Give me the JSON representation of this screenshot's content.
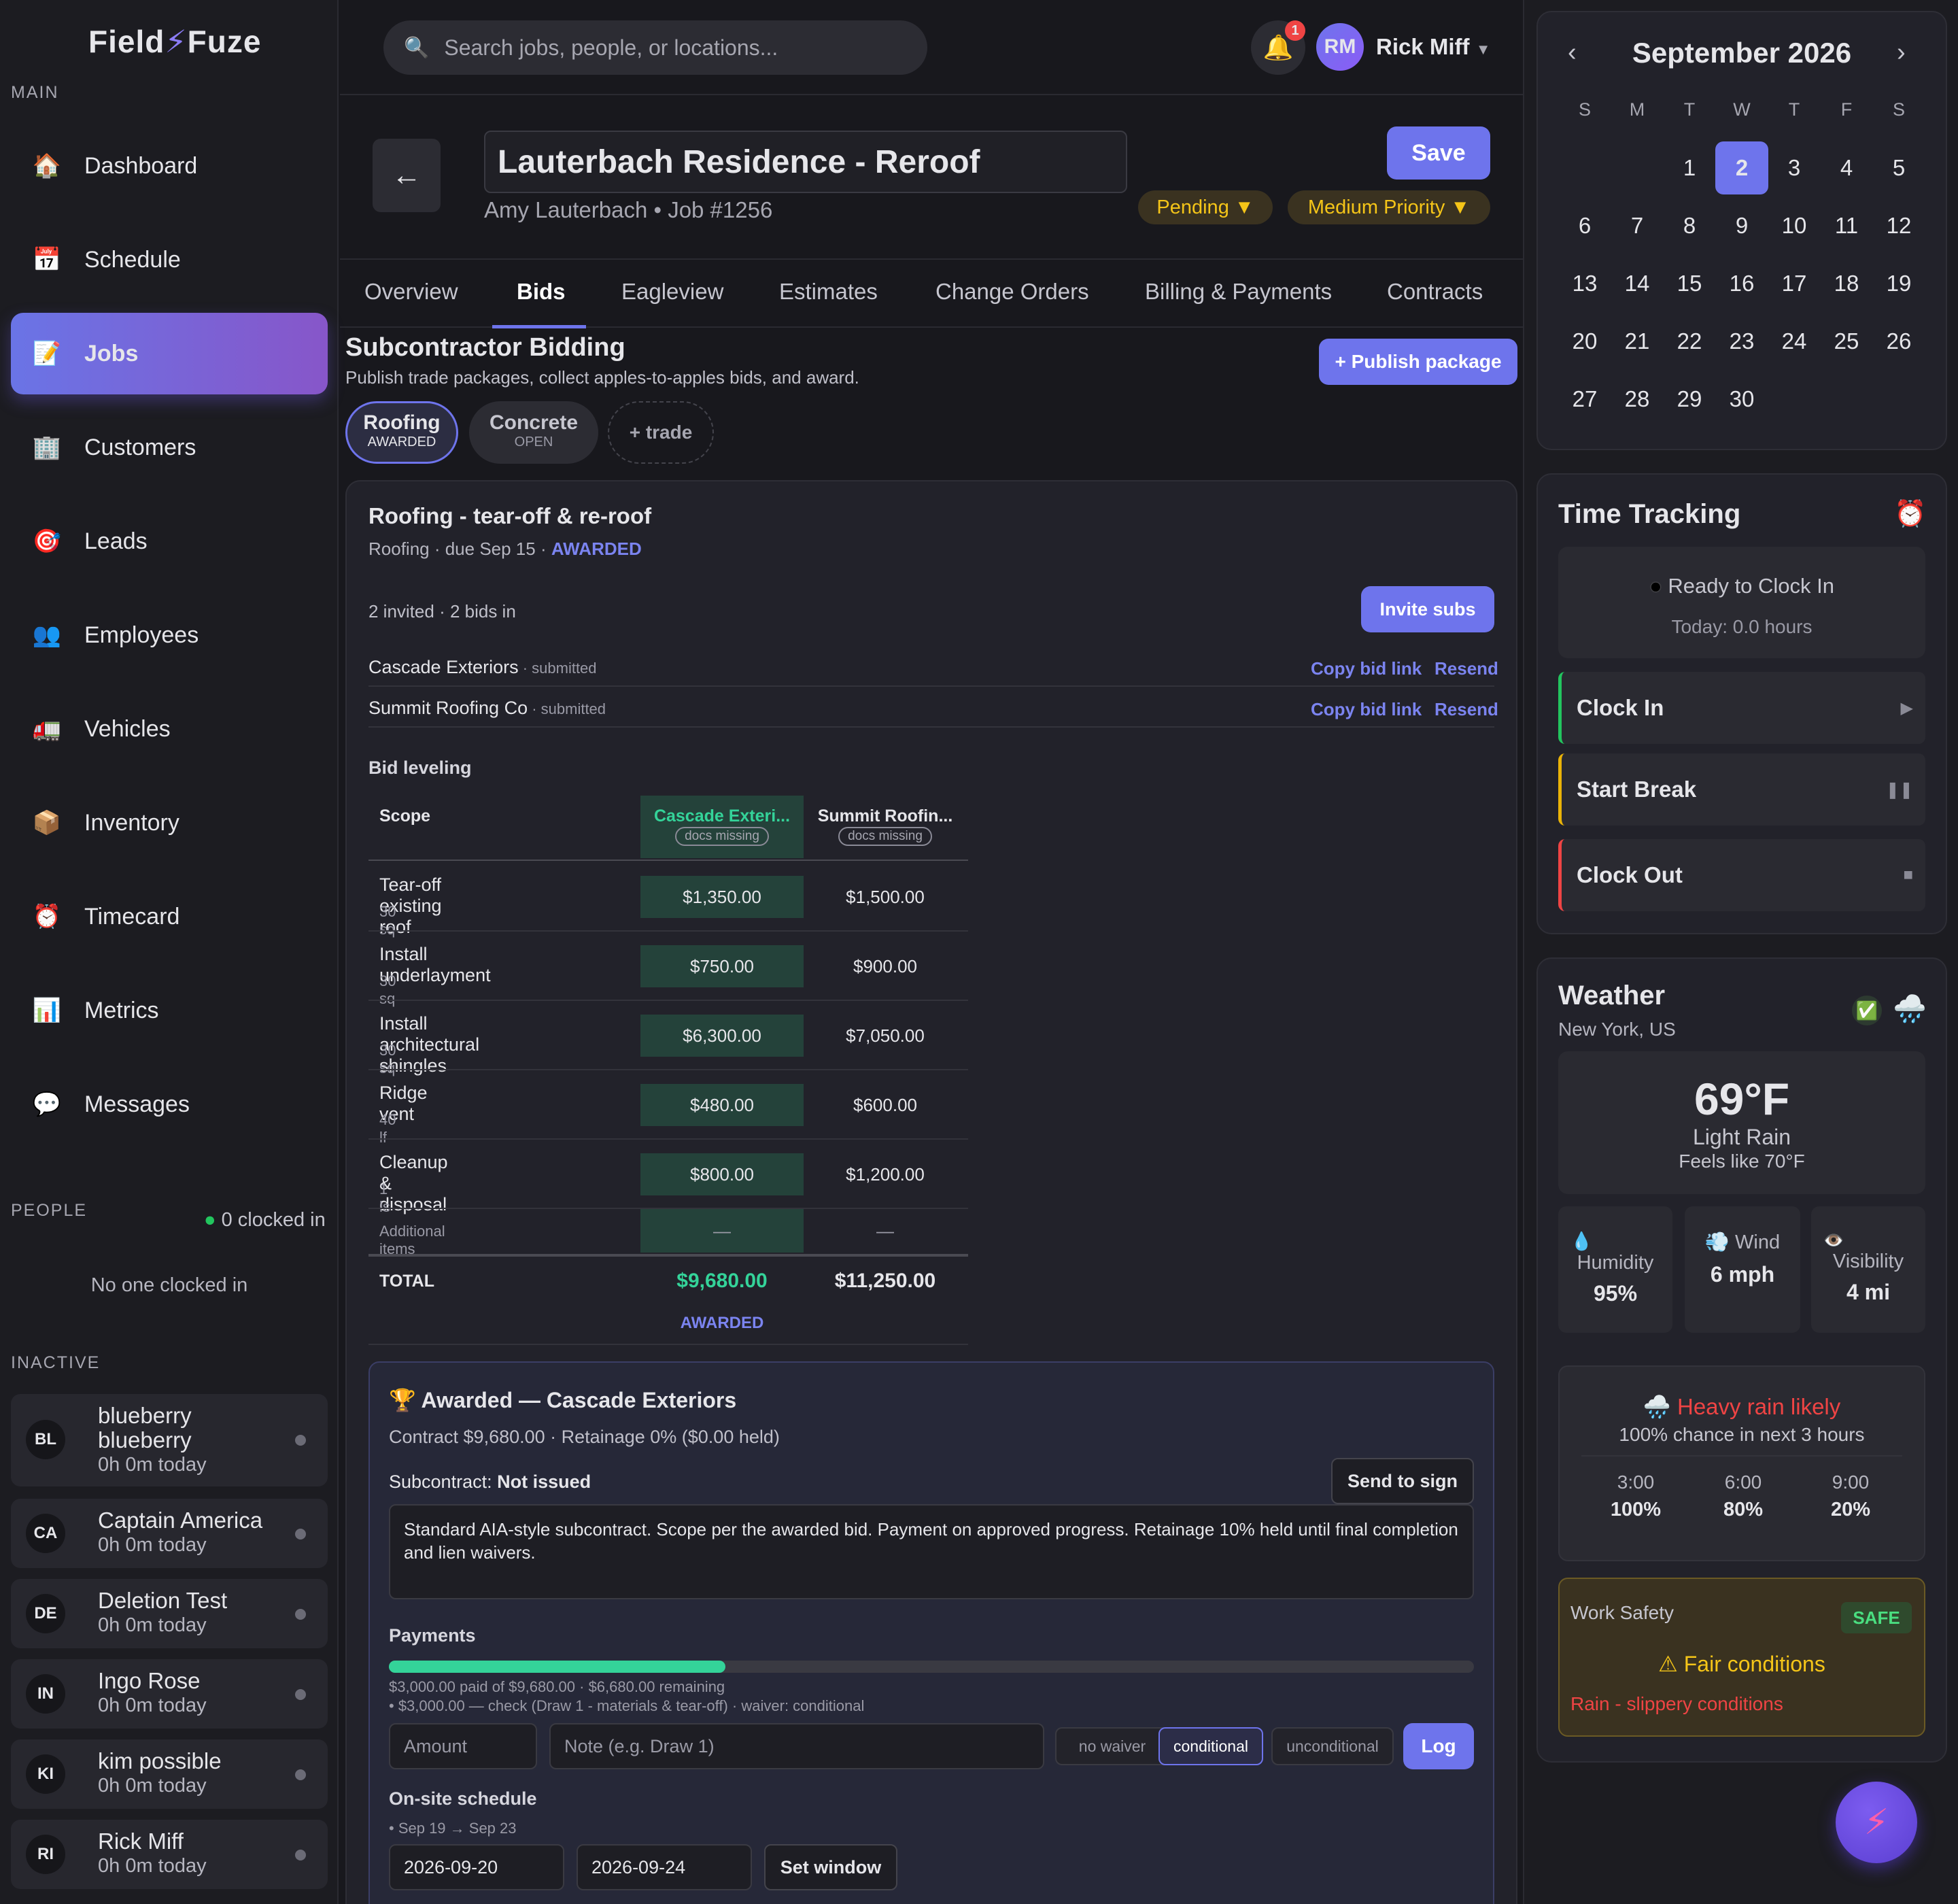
{
  "app": {
    "brand_left": "Field",
    "brand_right": "Fuze"
  },
  "sidebar": {
    "main_label": "MAIN",
    "items": [
      {
        "label": "Dashboard",
        "icon": "🏠"
      },
      {
        "label": "Schedule",
        "icon": "📅"
      },
      {
        "label": "Jobs",
        "icon": "📝"
      },
      {
        "label": "Customers",
        "icon": "🏢"
      },
      {
        "label": "Leads",
        "icon": "🎯"
      },
      {
        "label": "Employees",
        "icon": "👥"
      },
      {
        "label": "Vehicles",
        "icon": "🚛"
      },
      {
        "label": "Inventory",
        "icon": "📦"
      },
      {
        "label": "Timecard",
        "icon": "⏰"
      },
      {
        "label": "Metrics",
        "icon": "📊"
      },
      {
        "label": "Messages",
        "icon": "💬"
      }
    ],
    "people_label": "PEOPLE",
    "clocked_in": "0 clocked in",
    "no_one": "No one clocked in",
    "inactive_label": "INACTIVE",
    "people": [
      {
        "initials": "BL",
        "name": "blueberry blueberry",
        "time": "0h 0m today"
      },
      {
        "initials": "CA",
        "name": "Captain America",
        "time": "0h 0m today"
      },
      {
        "initials": "DE",
        "name": "Deletion Test",
        "time": "0h 0m today"
      },
      {
        "initials": "IN",
        "name": "Ingo Rose",
        "time": "0h 0m today"
      },
      {
        "initials": "KI",
        "name": "kim possible",
        "time": "0h 0m today"
      },
      {
        "initials": "RI",
        "name": "Rick Miff",
        "time": "0h 0m today"
      }
    ]
  },
  "topbar": {
    "search_placeholder": "Search jobs, people, or locations...",
    "notif_count": "1",
    "user_initials": "RM",
    "user_name": "Rick Miff"
  },
  "job": {
    "title": "Lauterbach Residence - Reroof",
    "subtitle": "Amy Lauterbach • Job #1256",
    "save_label": "Save",
    "status": "Pending",
    "priority": "Medium Priority"
  },
  "tabs": [
    "Overview",
    "Bids",
    "Eagleview",
    "Estimates",
    "Change Orders",
    "Billing & Payments",
    "Contracts"
  ],
  "bidding": {
    "title": "Subcontractor Bidding",
    "subtitle": "Publish trade packages, collect apples-to-apples bids, and award.",
    "publish_label": "+ Publish package",
    "chips": [
      {
        "name": "Roofing",
        "status": "AWARDED"
      },
      {
        "name": "Concrete",
        "status": "OPEN"
      },
      {
        "name": "+ trade",
        "status": ""
      }
    ],
    "package_title": "Roofing - tear-off & re-roof",
    "package_meta": "Roofing · due Sep 15 · ",
    "package_status": "AWARDED",
    "invite_summary": "2 invited · 2 bids in",
    "invite_label": "Invite subs",
    "invitees": [
      {
        "name": "Cascade Exteriors",
        "status": " · submitted"
      },
      {
        "name": "Summit Roofing Co",
        "status": " · submitted"
      }
    ],
    "copy_label": "Copy bid link",
    "resend_label": "Resend",
    "leveling_label": "Bid leveling",
    "scope_header": "Scope",
    "bidders": [
      {
        "name": "Cascade Exteri...",
        "badge": "docs missing"
      },
      {
        "name": "Summit Roofin...",
        "badge": "docs missing"
      }
    ],
    "rows": [
      {
        "scope": "Tear-off existing roof",
        "unit": "30 sq",
        "a": "$1,350.00",
        "b": "$1,500.00"
      },
      {
        "scope": "Install underlayment",
        "unit": "30 sq",
        "a": "$750.00",
        "b": "$900.00"
      },
      {
        "scope": "Install architectural shingles",
        "unit": "30 sq",
        "a": "$6,300.00",
        "b": "$7,050.00"
      },
      {
        "scope": "Ridge vent",
        "unit": "40 lf",
        "a": "$480.00",
        "b": "$600.00"
      },
      {
        "scope": "Cleanup & disposal",
        "unit": "1 ls",
        "a": "$800.00",
        "b": "$1,200.00"
      }
    ],
    "additional": {
      "label": "Additional items",
      "a": "—",
      "b": "—"
    },
    "total_label": "TOTAL",
    "total_a": "$9,680.00",
    "total_b": "$11,250.00",
    "awarded_tag": "AWARDED"
  },
  "award": {
    "title": "Awarded — Cascade Exteriors",
    "contract_line": "Contract $9,680.00 · Retainage 0% ($0.00 held)",
    "subcontract_label": "Subcontract: ",
    "subcontract_status": "Not issued",
    "send_label": "Send to sign",
    "terms": "Standard AIA-style subcontract. Scope per the awarded bid. Payment on approved progress. Retainage 10% held until final completion and lien waivers.",
    "payments_label": "Payments",
    "paid_fraction": 0.31,
    "paid_line": "$3,000.00 paid of $9,680.00 · $6,680.00 remaining",
    "payment_item": "• $3,000.00 — check (Draw 1 - materials & tear-off) · waiver: conditional",
    "amount_placeholder": "Amount",
    "note_placeholder": "Note (e.g. Draw 1)",
    "waivers": [
      "no waiver",
      "conditional",
      "unconditional"
    ],
    "log_label": "Log",
    "schedule_label": "On-site schedule",
    "schedule_item": "• Sep 19 → Sep 23",
    "start_date": "2026-09-20",
    "end_date": "2026-09-24",
    "set_window_label": "Set window"
  },
  "calendar": {
    "month": "September 2026",
    "weekdays": [
      "S",
      "M",
      "T",
      "W",
      "T",
      "F",
      "S"
    ],
    "selected": "2"
  },
  "time_tracking": {
    "title": "Time Tracking",
    "status": "Ready to Clock In",
    "today": "Today: 0.0 hours",
    "clock_in": "Clock In",
    "start_break": "Start Break",
    "clock_out": "Clock Out"
  },
  "weather": {
    "title": "Weather",
    "location": "New York, US",
    "temp": "69°F",
    "condition": "Light Rain",
    "feels": "Feels like 70°F",
    "humidity_label": "Humidity",
    "humidity": "95%",
    "wind_label": "Wind",
    "wind": "6 mph",
    "visibility_label": "Visibility",
    "visibility": "4 mi",
    "alert_title": "Heavy rain likely",
    "alert_sub": "100% chance in next 3 hours",
    "forecast": [
      {
        "time": "3:00",
        "pct": "100%"
      },
      {
        "time": "6:00",
        "pct": "80%"
      },
      {
        "time": "9:00",
        "pct": "20%"
      }
    ],
    "safety_label": "Work Safety",
    "safety_badge": "SAFE",
    "safety_title": "Fair conditions",
    "safety_note": "Rain - slippery conditions"
  },
  "colors": {
    "accent": "#6e74ec",
    "success": "#34d399",
    "warning": "#f5c518",
    "danger": "#ef4444"
  }
}
